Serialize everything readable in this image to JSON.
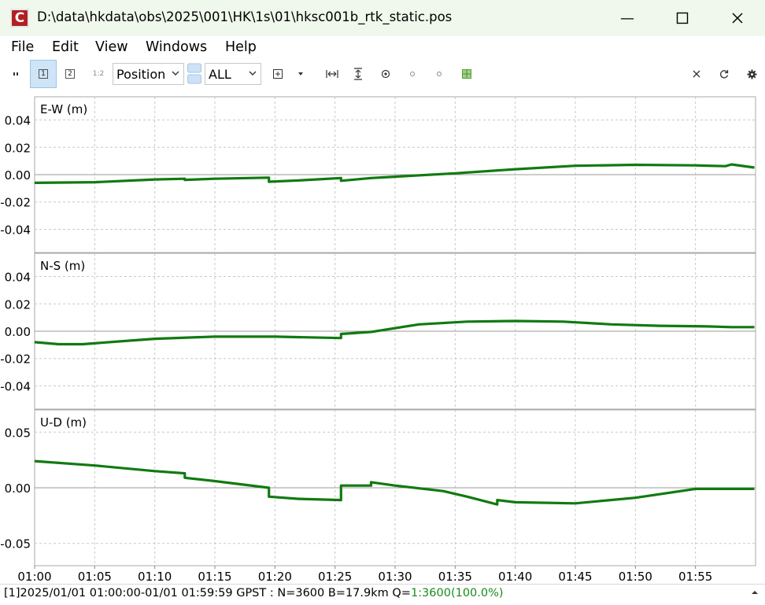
{
  "window": {
    "title": "D:\\data\\hkdata\\obs\\2025\\001\\HK\\1s\\01\\hksc001b_rtk_static.pos",
    "app_icon_letter": "C",
    "minimize_glyph": "—",
    "maximize_glyph": "☐",
    "close_glyph": "✕"
  },
  "menu": [
    "File",
    "Edit",
    "View",
    "Windows",
    "Help"
  ],
  "toolbar": {
    "btn1": "1",
    "btn2": "2",
    "btn12": "1:2",
    "plot_type": "Position",
    "quality": "ALL",
    "icons": [
      "origin-icon",
      "dropdown-icon",
      "fit-horizontal-icon",
      "fit-vertical-icon",
      "center-icon",
      "dot-icon",
      "dot-icon",
      "map-icon",
      "close-icon",
      "refresh-icon",
      "settings-icon"
    ]
  },
  "status": {
    "text": "[1]2025/01/01 01:00:00-01/01 01:59:59 GPST : N=3600 B=17.9km Q=",
    "quality": "1:3600(100.0%)",
    "quality_color": "#1a8a1a"
  },
  "chart_data": [
    {
      "type": "line",
      "title": "E-W (m)",
      "ylim": [
        -0.057,
        0.057
      ],
      "yticks": [
        "0.04",
        "0.02",
        "0.00",
        "-0.02",
        "-0.04"
      ],
      "ytick_values": [
        0.04,
        0.02,
        0.0,
        -0.02,
        -0.04
      ],
      "color": "#117a11",
      "x": [
        0,
        5,
        10,
        12.5,
        12.5,
        15,
        19.5,
        19.5,
        22,
        25.5,
        25.5,
        28,
        30,
        35,
        40,
        45,
        50,
        55,
        57.5,
        58,
        59.9
      ],
      "y": [
        -0.006,
        -0.0055,
        -0.0035,
        -0.003,
        -0.0038,
        -0.003,
        -0.0022,
        -0.0052,
        -0.0042,
        -0.0025,
        -0.0045,
        -0.0025,
        -0.0015,
        0.001,
        0.004,
        0.0065,
        0.0072,
        0.0068,
        0.0062,
        0.0075,
        0.0052
      ],
      "grid": true
    },
    {
      "type": "line",
      "title": "N-S (m)",
      "ylim": [
        -0.057,
        0.057
      ],
      "yticks": [
        "0.04",
        "0.02",
        "0.00",
        "-0.02",
        "-0.04"
      ],
      "ytick_values": [
        0.04,
        0.02,
        0.0,
        -0.02,
        -0.04
      ],
      "color": "#117a11",
      "x": [
        0,
        2,
        4,
        7,
        10,
        15,
        20,
        25.5,
        25.5,
        28,
        32,
        36,
        40,
        44,
        48,
        52,
        56,
        58,
        59.9
      ],
      "y": [
        -0.008,
        -0.0095,
        -0.0095,
        -0.0075,
        -0.0055,
        -0.004,
        -0.004,
        -0.005,
        -0.002,
        -0.0005,
        0.005,
        0.007,
        0.0075,
        0.007,
        0.005,
        0.004,
        0.0035,
        0.003,
        0.003
      ],
      "grid": true
    },
    {
      "type": "line",
      "title": "U-D (m)",
      "ylim": [
        -0.07,
        0.07
      ],
      "yticks": [
        "0.05",
        "0.00",
        "-0.05"
      ],
      "ytick_values": [
        0.05,
        0.0,
        -0.05
      ],
      "color": "#117a11",
      "x": [
        0,
        5,
        10,
        12.5,
        12.5,
        15,
        19.5,
        19.5,
        22,
        25.5,
        25.5,
        28,
        28,
        30,
        34,
        36,
        38.5,
        38.5,
        40,
        45,
        50,
        55,
        59.9
      ],
      "y": [
        0.024,
        0.02,
        0.015,
        0.013,
        0.009,
        0.006,
        0.0,
        -0.008,
        -0.01,
        -0.011,
        0.002,
        0.002,
        0.005,
        0.002,
        -0.003,
        -0.008,
        -0.015,
        -0.011,
        -0.013,
        -0.014,
        -0.009,
        -0.001,
        -0.001
      ],
      "grid": true
    }
  ],
  "xaxis": {
    "ticks": [
      "01:00",
      "01:05",
      "01:10",
      "01:15",
      "01:20",
      "01:25",
      "01:30",
      "01:35",
      "01:40",
      "01:45",
      "01:50",
      "01:55"
    ],
    "tick_minutes": [
      0,
      5,
      10,
      15,
      20,
      25,
      30,
      35,
      40,
      45,
      50,
      55
    ],
    "xlim_minutes": [
      0,
      60
    ]
  }
}
